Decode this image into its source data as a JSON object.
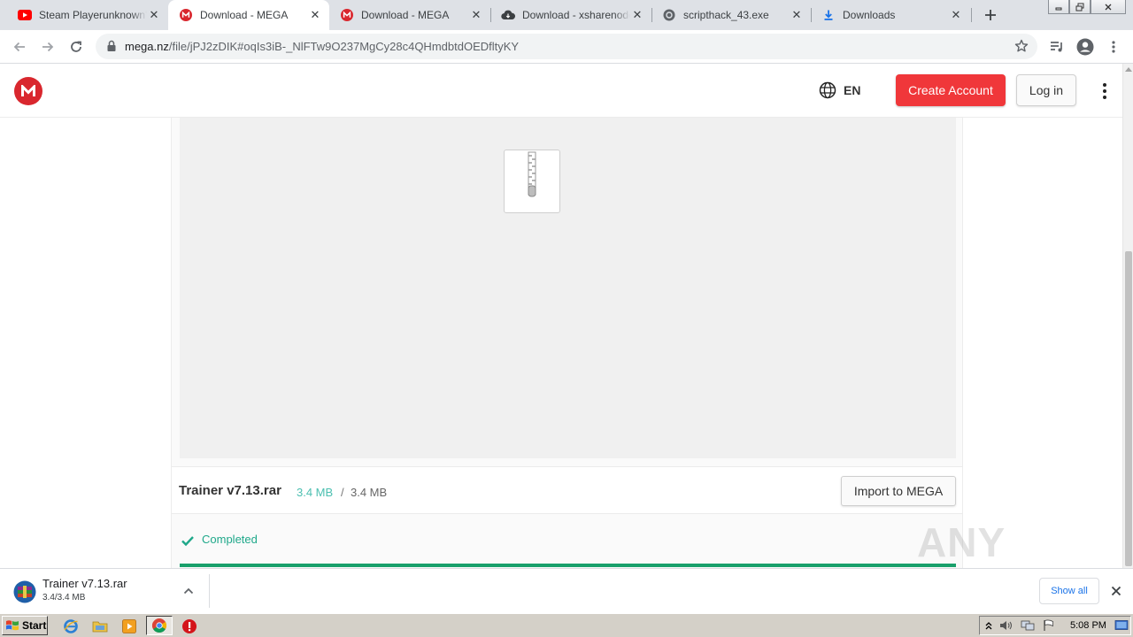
{
  "browser": {
    "tabs": [
      {
        "title": "Steam Playerunknown's B",
        "icon": "youtube-icon",
        "active": false
      },
      {
        "title": "Download - MEGA",
        "icon": "mega-icon",
        "active": true
      },
      {
        "title": "Download - MEGA",
        "icon": "mega-icon",
        "active": false
      },
      {
        "title": "Download - xsharenode",
        "icon": "cloud-download-icon",
        "active": false
      },
      {
        "title": "scripthack_43.exe",
        "icon": "globe-icon",
        "active": false
      },
      {
        "title": "Downloads",
        "icon": "download-icon",
        "active": false
      }
    ],
    "url_host": "mega.nz",
    "url_path": "/file/jPJ2zDIK#oqIs3iB-_NlFTw9O237MgCy28c4QHmdbtdOEDfltyKY"
  },
  "mega": {
    "lang_label": "EN",
    "create_account_label": "Create Account",
    "login_label": "Log in",
    "brand_color": "#d9272e"
  },
  "file": {
    "name": "Trainer v7.13.rar",
    "downloaded": "3.4 MB",
    "separator": "/",
    "total": "3.4 MB",
    "import_label": "Import to MEGA",
    "status": "Completed",
    "progress_percent": 100
  },
  "download_shelf": {
    "item_name": "Trainer v7.13.rar",
    "item_size": "3.4/3.4 MB",
    "show_all_label": "Show all"
  },
  "watermark": "ANY RUN",
  "taskbar": {
    "start_label": "Start",
    "clock": "5:08 PM"
  }
}
